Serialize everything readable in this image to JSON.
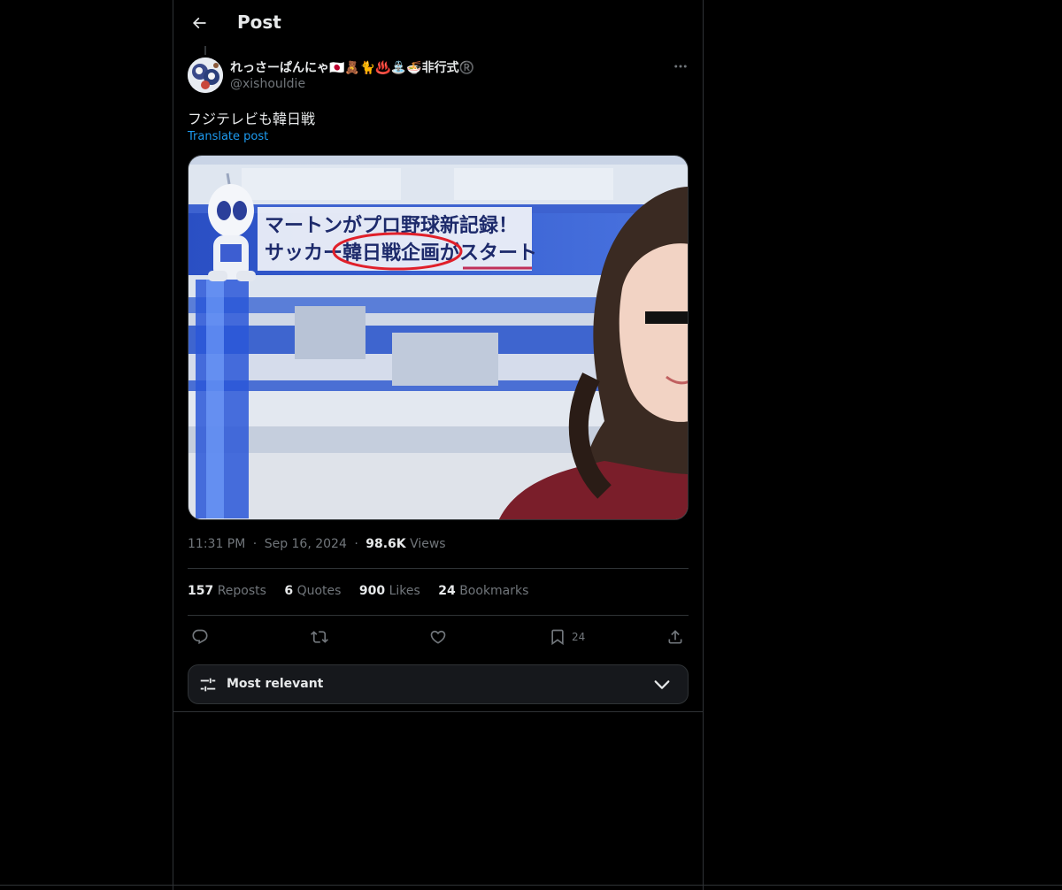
{
  "header": {
    "title": "Post",
    "back_icon": "arrow-left-icon"
  },
  "author": {
    "display_name": "れっさーぱんにゃ🇯🇵🧸🐈♨️⛲🍜非行式®️",
    "handle": "@xishouldie",
    "avatar_icon": "avatar-image",
    "more_icon": "more-horizontal-icon"
  },
  "post": {
    "text": "フジテレビも韓日戦",
    "translate_label": "Translate post",
    "media": {
      "caption_line1": "マートンがプロ野球新記録！",
      "caption_line2": "サッカー韓日戦企画がスタート"
    }
  },
  "meta": {
    "time": "11:31 PM",
    "date": "Sep 16, 2024",
    "views_count": "98.6K",
    "views_label": "Views",
    "dot": "·"
  },
  "stats": {
    "reposts_count": "157",
    "reposts_label": "Reposts",
    "quotes_count": "6",
    "quotes_label": "Quotes",
    "likes_count": "900",
    "likes_label": "Likes",
    "bookmarks_count": "24",
    "bookmarks_label": "Bookmarks"
  },
  "actions": {
    "reply_icon": "reply-icon",
    "repost_icon": "repost-icon",
    "like_icon": "heart-icon",
    "bookmark_icon": "bookmark-icon",
    "bookmark_count": "24",
    "share_icon": "share-icon"
  },
  "sort": {
    "label": "Most relevant",
    "icon": "sliders-icon",
    "chevron": "chevron-down-icon"
  },
  "colors": {
    "background": "#000000",
    "text_primary": "#e7e9ea",
    "text_secondary": "#71767b",
    "link": "#1d9bf0",
    "border": "#2f3336",
    "sort_bg": "#16181c"
  }
}
